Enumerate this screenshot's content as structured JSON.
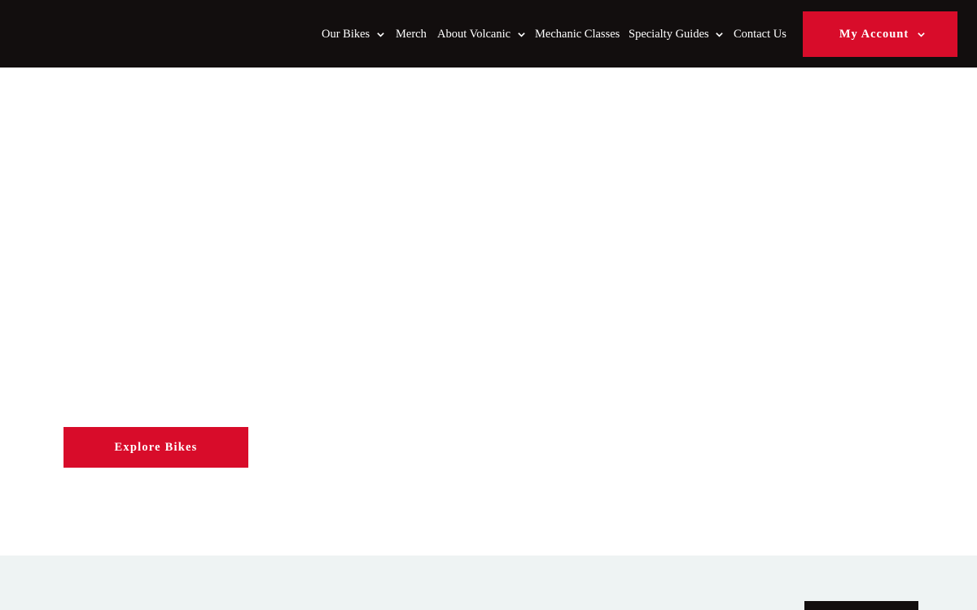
{
  "nav": {
    "items": [
      {
        "label": "Our Bikes",
        "dropdown": true
      },
      {
        "label": "Merch",
        "dropdown": false
      },
      {
        "label": "About Volcanic",
        "dropdown": true
      },
      {
        "label": "Mechanic Classes",
        "dropdown": false
      },
      {
        "label": "Specialty Guides",
        "dropdown": true
      },
      {
        "label": "Contact Us",
        "dropdown": false
      }
    ],
    "account_label": "My Account",
    "chevron_icon": "chevron-down-icon"
  },
  "hero": {
    "cta_label": "Explore Bikes"
  },
  "colors": {
    "header_bg": "#120e0e",
    "accent": "#d80c2a",
    "lower_bg": "#eef3f3"
  }
}
